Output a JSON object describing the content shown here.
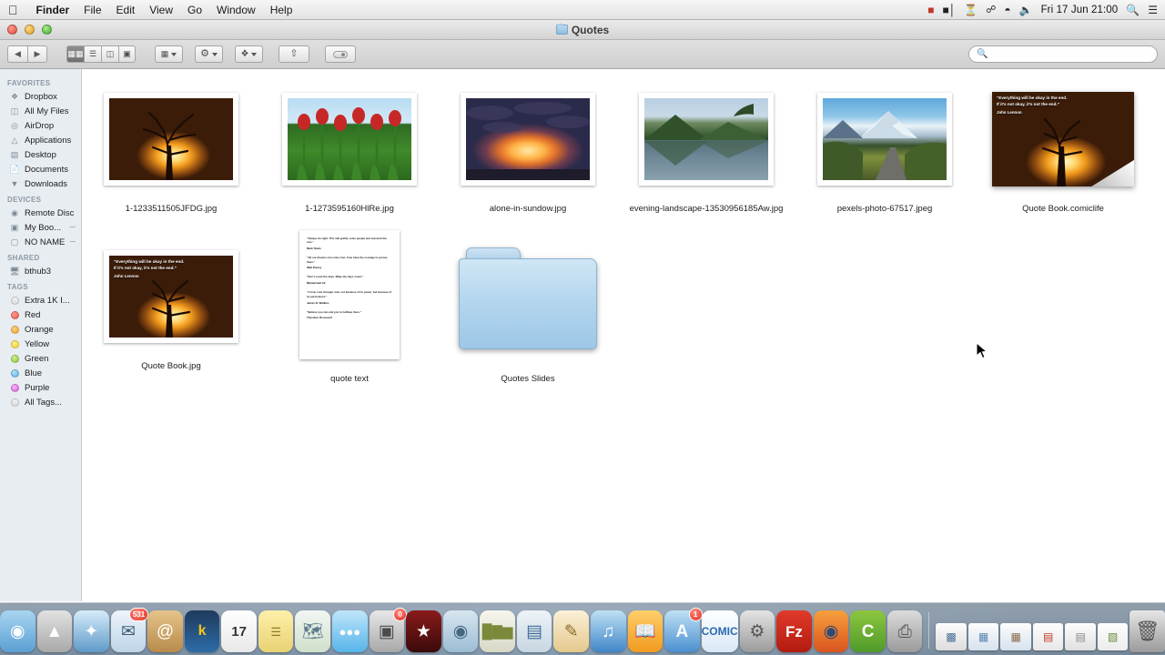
{
  "menubar": {
    "apple_glyph": "apple-logo",
    "items": [
      {
        "label": "Finder",
        "bold": true
      },
      {
        "label": "File",
        "bold": false
      },
      {
        "label": "Edit",
        "bold": false
      },
      {
        "label": "View",
        "bold": false
      },
      {
        "label": "Go",
        "bold": false
      },
      {
        "label": "Window",
        "bold": false
      },
      {
        "label": "Help",
        "bold": false
      }
    ],
    "status_icons": [
      "dropbox-icon",
      "battery-icon",
      "timemachine-icon",
      "bluetooth-icon",
      "wifi-icon",
      "volume-icon"
    ],
    "clock": "Fri 17 Jun  21:00",
    "search_icon": "spotlight-search-icon",
    "notification_icon": "notification-center-icon"
  },
  "window": {
    "title": "Quotes",
    "back_label": "◀",
    "forward_label": "▶"
  },
  "toolbar": {
    "view_modes": [
      {
        "name": "icon-view",
        "glyph": "▒",
        "active": true
      },
      {
        "name": "list-view",
        "glyph": "≡",
        "active": false
      },
      {
        "name": "column-view",
        "glyph": "‖",
        "active": false
      },
      {
        "name": "coverflow-view",
        "glyph": "▣",
        "active": false
      }
    ],
    "arrange_label": "arrange-dropdown",
    "action_label": "action-gear-dropdown",
    "dropbox_label": "dropbox-dropdown",
    "share_label": "share-button",
    "tags_label": "tags-button"
  },
  "search": {
    "value": "",
    "placeholder": "",
    "icon": "search-icon"
  },
  "sidebar": {
    "sections": [
      {
        "header": "FAVORITES",
        "items": [
          {
            "label": "Dropbox",
            "icon": "dropbox-icon",
            "eject": false
          },
          {
            "label": "All My Files",
            "icon": "all-my-files-icon",
            "eject": false
          },
          {
            "label": "AirDrop",
            "icon": "airdrop-icon",
            "eject": false
          },
          {
            "label": "Applications",
            "icon": "applications-icon",
            "eject": false
          },
          {
            "label": "Desktop",
            "icon": "desktop-icon",
            "eject": false
          },
          {
            "label": "Documents",
            "icon": "documents-icon",
            "eject": false
          },
          {
            "label": "Downloads",
            "icon": "downloads-icon",
            "eject": false
          }
        ]
      },
      {
        "header": "DEVICES",
        "items": [
          {
            "label": "Remote Disc",
            "icon": "remote-disc-icon",
            "eject": false
          },
          {
            "label": "My Boo...",
            "icon": "external-drive-icon",
            "eject": true
          },
          {
            "label": "NO NAME",
            "icon": "volume-drive-icon",
            "eject": true
          }
        ]
      },
      {
        "header": "SHARED",
        "items": [
          {
            "label": "bthub3",
            "icon": "shared-computer-icon",
            "eject": false
          }
        ]
      },
      {
        "header": "TAGS",
        "items": [
          {
            "label": "Extra 1K I...",
            "icon": "tag-dot-grey",
            "color": "#e6e6e6",
            "eject": false
          },
          {
            "label": "Red",
            "icon": "tag-dot-red",
            "color": "#f0584d",
            "eject": false
          },
          {
            "label": "Orange",
            "icon": "tag-dot-orange",
            "color": "#f5a623",
            "eject": false
          },
          {
            "label": "Yellow",
            "icon": "tag-dot-yellow",
            "color": "#f8d41e",
            "eject": false
          },
          {
            "label": "Green",
            "icon": "tag-dot-green",
            "color": "#8cc63e",
            "eject": false
          },
          {
            "label": "Blue",
            "icon": "tag-dot-blue",
            "color": "#58b4e5",
            "eject": false
          },
          {
            "label": "Purple",
            "icon": "tag-dot-purple",
            "color": "#e05ce0",
            "eject": false
          },
          {
            "label": "All Tags...",
            "icon": "tag-dot-grey",
            "color": "#e6e6e6",
            "eject": false
          }
        ]
      }
    ]
  },
  "files": {
    "row1": [
      {
        "name": "1-1233511505JFDG.jpg",
        "kind": "photo-tree-sunset"
      },
      {
        "name": "1-1273595160HlRe.jpg",
        "kind": "photo-red-tulips"
      },
      {
        "name": "alone-in-sundow.jpg",
        "kind": "photo-sunset-clouds"
      },
      {
        "name": "evening-landscape-13530956185Aw.jpg",
        "kind": "photo-lake-mountain"
      },
      {
        "name": "pexels-photo-67517.jpeg",
        "kind": "photo-snow-mountain-road"
      },
      {
        "name": "Quote Book.comiclife",
        "kind": "comiclife-document"
      }
    ],
    "row2": [
      {
        "name": "Quote Book.jpg",
        "kind": "photo-quote-tree"
      },
      {
        "name": "quote text",
        "kind": "text-document"
      },
      {
        "name": "Quotes Slides",
        "kind": "folder"
      }
    ]
  },
  "quote_overlay": {
    "line1": "“Everything will be okay in the end.",
    "line2": "If it’s not okay, it’s not the end.”",
    "author": "John Lennon"
  },
  "quote_text_doc": {
    "quotes": [
      {
        "text": "“Always do right. This will gratify some people and astonish the rest.”",
        "author": "Mark Twain"
      },
      {
        "text": "“All our dreams can come true, if we have the courage to pursue them.”",
        "author": "Walt Disney"
      },
      {
        "text": "“Don’t count the days. Make the days count.”",
        "author": "Muhammad Ali"
      },
      {
        "text": "“A river cuts through rock, not because of its power, but because of its persistence.”",
        "author": "James N. Watkins"
      },
      {
        "text": "“Believe you can and you’re halfway there.”",
        "author": "Theodore Roosevelt"
      }
    ]
  },
  "dock": {
    "items": [
      {
        "name": "finder",
        "glyph": "◑",
        "bg": "linear-gradient(#a9d6f0,#5a9fd4)",
        "badge": ""
      },
      {
        "name": "launchpad",
        "glyph": "▲",
        "bg": "linear-gradient(#dcdcdc,#a8a8a8)",
        "badge": ""
      },
      {
        "name": "safari",
        "glyph": "✦",
        "bg": "linear-gradient(#cfe6f7,#5e9ac8)",
        "badge": ""
      },
      {
        "name": "mail",
        "glyph": "✉",
        "bg": "linear-gradient(#eef4fb,#bdd4e8)",
        "badge": "531"
      },
      {
        "name": "contacts",
        "glyph": "@",
        "bg": "linear-gradient(#e6c48a,#b88a4a)",
        "badge": ""
      },
      {
        "name": "kindle",
        "glyph": "k",
        "bg": "linear-gradient(#1c1c1c,#3a6fa8)",
        "badge": ""
      },
      {
        "name": "calendar",
        "glyph": "17",
        "bg": "linear-gradient(#ffffff,#e8e8e8)",
        "badge": ""
      },
      {
        "name": "notes",
        "glyph": "☰",
        "bg": "linear-gradient(#fdf0a8,#e8d274)",
        "badge": ""
      },
      {
        "name": "maps",
        "glyph": "⦵",
        "bg": "linear-gradient(#f2f6f2,#cfe0cb)",
        "badge": ""
      },
      {
        "name": "messages",
        "glyph": "●●●",
        "bg": "linear-gradient(#bfe6fa,#56b4ea)",
        "badge": ""
      },
      {
        "name": "facetime",
        "glyph": "■",
        "bg": "linear-gradient(#e8e8e8,#b0b0b0)",
        "badge": "0"
      },
      {
        "name": "imovie",
        "glyph": "★",
        "bg": "linear-gradient(#4a4a4a,#1c1c1c)",
        "badge": ""
      },
      {
        "name": "iphoto",
        "glyph": "◉",
        "bg": "linear-gradient(#d8e6f0,#9bbcd4)",
        "badge": ""
      },
      {
        "name": "numbers",
        "glyph": "▂▆▄",
        "bg": "linear-gradient(#f6f6ee,#d8d8c8)",
        "badge": ""
      },
      {
        "name": "keynote",
        "glyph": "▤",
        "bg": "linear-gradient(#eef3f8,#c7d6e2)",
        "badge": ""
      },
      {
        "name": "pages",
        "glyph": "✎",
        "bg": "linear-gradient(#fbf0d8,#e4c98c)",
        "badge": ""
      },
      {
        "name": "itunes",
        "glyph": "♫",
        "bg": "linear-gradient(#bfe0f5,#3f86c8)",
        "badge": ""
      },
      {
        "name": "ibooks",
        "glyph": "▭",
        "bg": "linear-gradient(#ffcf6a,#f09a1e)",
        "badge": ""
      },
      {
        "name": "app-store",
        "glyph": "A",
        "bg": "linear-gradient(#bfe0f5,#4a8fd0)",
        "badge": "1"
      },
      {
        "name": "comic-life",
        "glyph": "C",
        "bg": "linear-gradient(#ffffff,#d8e8f6)",
        "badge": ""
      },
      {
        "name": "system-preferences",
        "glyph": "⚙",
        "bg": "linear-gradient(#e4e4e4,#9a9a9a)",
        "badge": ""
      },
      {
        "name": "filezilla",
        "glyph": "Fz",
        "bg": "linear-gradient(#e03a2a,#b31b10)",
        "badge": ""
      },
      {
        "name": "firefox",
        "glyph": "◕",
        "bg": "linear-gradient(#f7a03c,#d9541e)",
        "badge": ""
      },
      {
        "name": "evernote",
        "glyph": "C",
        "bg": "linear-gradient(#8dc63f,#4f9a2a)",
        "badge": ""
      },
      {
        "name": "image-capture",
        "glyph": "✇",
        "bg": "linear-gradient(#dcdcdc,#9a9a9a)",
        "badge": ""
      },
      {
        "name": "chrome",
        "glyph": "◉",
        "bg": "linear-gradient(#e84b3a,#c0392b)",
        "badge": ""
      }
    ],
    "minimized": [
      {
        "name": "minimized-window-preview",
        "glyph": "☷"
      },
      {
        "name": "minimized-window-finder",
        "glyph": "▦"
      },
      {
        "name": "minimized-window-finder",
        "glyph": "▦"
      },
      {
        "name": "minimized-window-firefox",
        "glyph": "▤"
      },
      {
        "name": "minimized-window-firefox",
        "glyph": "▤"
      },
      {
        "name": "minimized-window-evernote",
        "glyph": "▧"
      }
    ],
    "trash": {
      "name": "trash",
      "glyph": "ᴴ"
    }
  }
}
